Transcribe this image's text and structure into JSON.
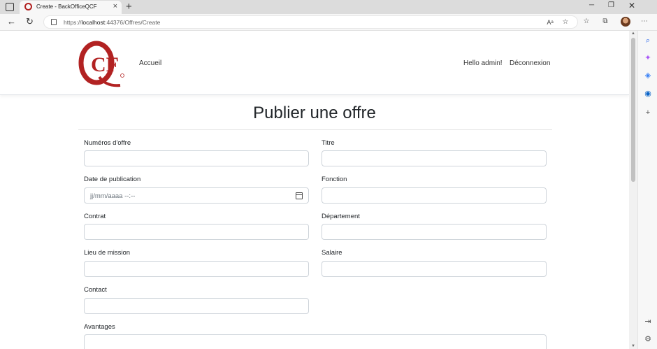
{
  "browser": {
    "tab_title": "Create - BackOfficeQCF",
    "url_prefix": "https://",
    "url_host": "localhost",
    "url_path": ":44376/Offres/Create",
    "new_tab_glyph": "+",
    "close_glyph": "×"
  },
  "navbar": {
    "logo_text": "QCF",
    "home_link": "Accueil",
    "greeting": "Hello admin!",
    "logout_link": "Déconnexion"
  },
  "page": {
    "title": "Publier une offre"
  },
  "form": {
    "numero_label": "Numéros d'offre",
    "titre_label": "Titre",
    "date_label": "Date de publication",
    "date_placeholder": "jj/mm/aaaa  --:--",
    "fonction_label": "Fonction",
    "contrat_label": "Contrat",
    "departement_label": "Département",
    "lieu_label": "Lieu de mission",
    "salaire_label": "Salaire",
    "contact_label": "Contact",
    "avantages_label": "Avantages"
  },
  "colors": {
    "brand": "#b22222",
    "text": "#212529",
    "border": "#ced4da"
  }
}
